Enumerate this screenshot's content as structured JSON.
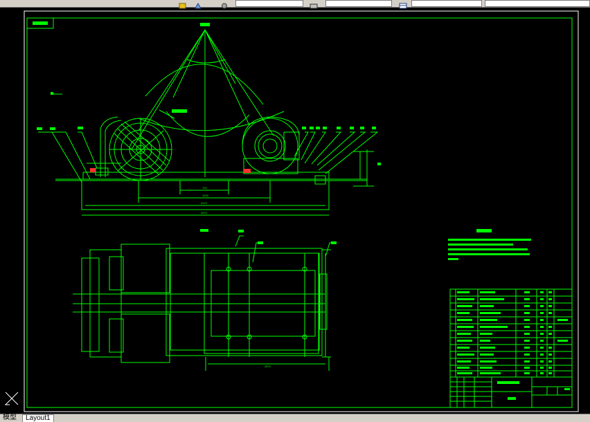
{
  "window": {
    "toolbar_icons": [
      "layer-icon",
      "shape-icon",
      "properties-icon",
      "plot-icon",
      "table-icon"
    ],
    "layer_combo": "",
    "linetype_combo": "",
    "lineweight_combo": "",
    "plotstyle_combo": ""
  },
  "tabs": [
    {
      "label": "模型",
      "active": false
    },
    {
      "label": "Layout1",
      "active": true
    }
  ],
  "colors": {
    "background": "#000000",
    "drawing_lines": "#00ff00",
    "text_blocks": "#00ff00",
    "ui_chrome": "#d4d0c8"
  },
  "drawing": {
    "front_view_dims": [
      "700",
      "800",
      "1000",
      "2470",
      "2870"
    ],
    "plan_view_dims": [
      "2870"
    ]
  }
}
